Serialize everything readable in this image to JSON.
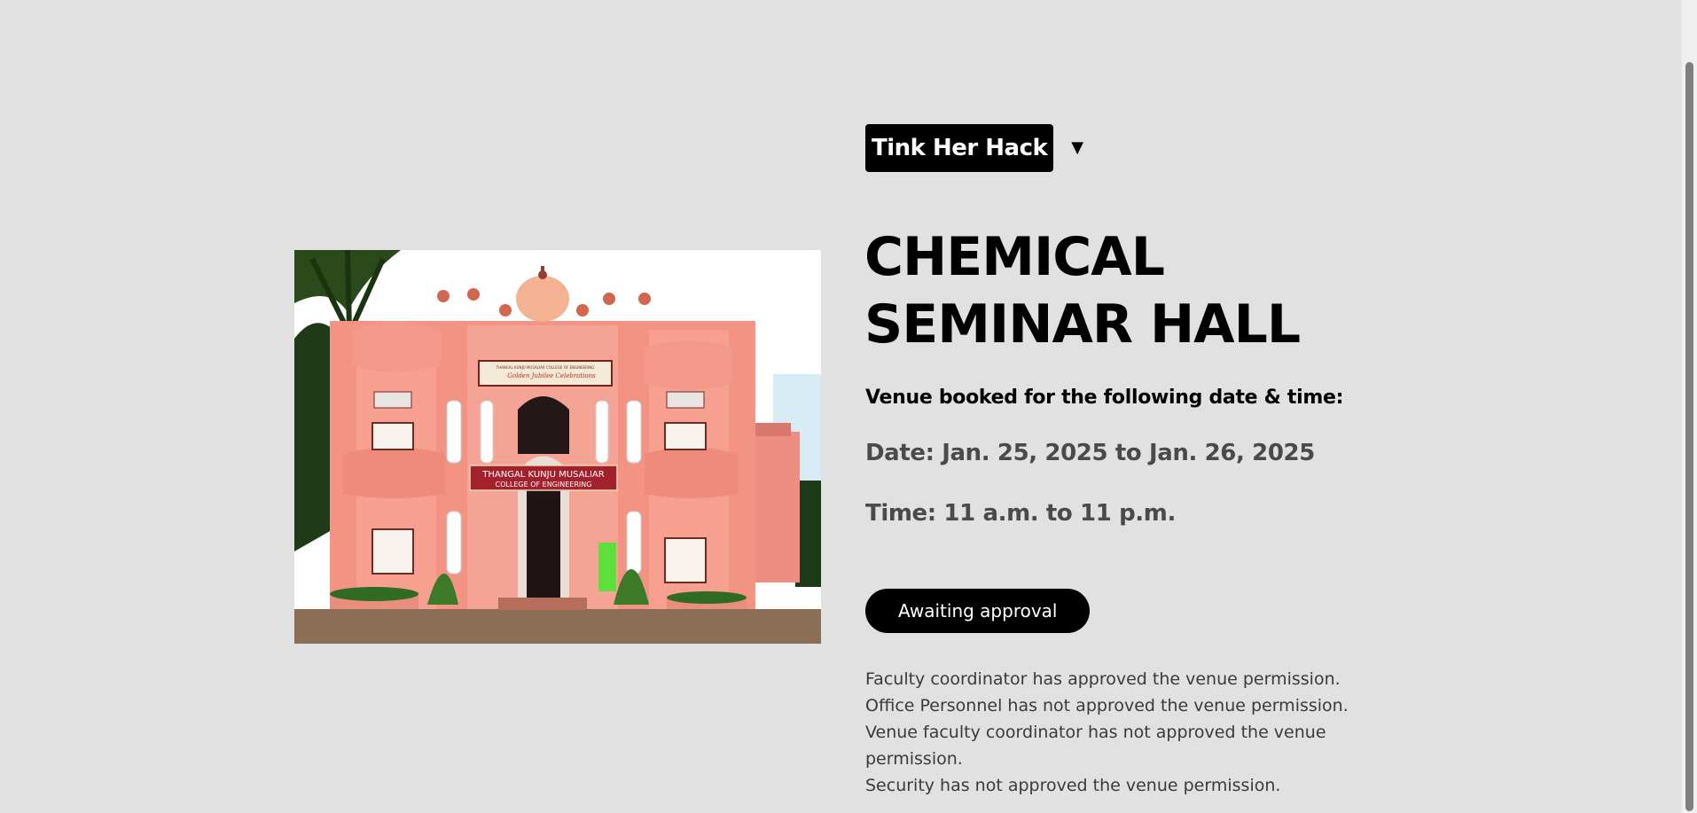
{
  "event": {
    "name": "Tink Her Hack",
    "dropdown_glyph": "▼"
  },
  "venue": {
    "title": "CHEMICAL SEMINAR HALL",
    "photo": {
      "banner_top": "THANGAL KUNJU MUSALIAR COLLEGE OF ENGINEERING",
      "banner_celebration": "Golden Jubilee Celebrations",
      "banner_main_line1": "THANGAL KUNJU MUSALIAR",
      "banner_main_line2": "COLLEGE OF ENGINEERING"
    }
  },
  "booking": {
    "intro": "Venue booked for the following date & time:",
    "date": "Date: Jan. 25, 2025 to Jan. 26, 2025",
    "time": "Time: 11 a.m. to 11 p.m."
  },
  "status": {
    "label": "Awaiting approval"
  },
  "approvals": [
    "Faculty coordinator has approved the venue permission.",
    "Office Personnel has not approved the venue permission.",
    "Venue faculty coordinator has not approved the venue permission.",
    "Security has not approved the venue permission."
  ],
  "colors": {
    "background": "#e1e1e1",
    "chip_bg": "#000000",
    "chip_text": "#ffffff",
    "detail_text": "#4a4a4a",
    "approval_text": "#3a3a3a",
    "building_pink": "#f08f80"
  }
}
